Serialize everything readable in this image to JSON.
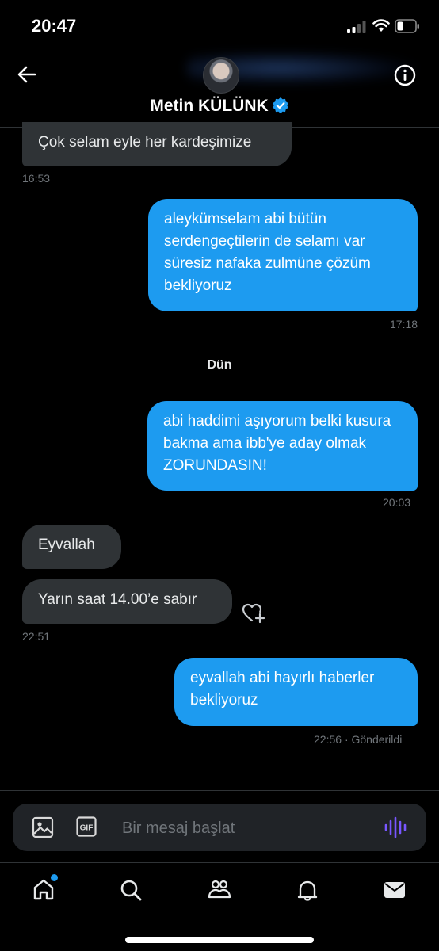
{
  "status_bar": {
    "time": "20:47",
    "icons": [
      "cellular-signal-icon",
      "wifi-icon",
      "battery-icon"
    ]
  },
  "header": {
    "contact_name": "Metin KÜLÜNK",
    "verified": true,
    "back_icon": "back-arrow-icon",
    "info_icon": "info-icon"
  },
  "messages": [
    {
      "direction": "incoming",
      "text": "Çok selam eyle her kardeşimize",
      "time": "16:53"
    },
    {
      "direction": "outgoing",
      "text": "aleykümselam abi bütün serdengeçtilerin de selamı var süresiz nafaka zulmüne çözüm bekliyoruz",
      "time": "17:18"
    },
    {
      "direction": "outgoing",
      "text": "abi haddimi aşıyorum belki kusura bakma ama ibb'ye aday olmak ZORUNDASIN!",
      "time": "20:03"
    },
    {
      "direction": "incoming",
      "text": "Eyvallah"
    },
    {
      "direction": "incoming",
      "text": "Yarın saat 14.00’e sabır",
      "time": "22:51"
    },
    {
      "direction": "outgoing",
      "text": "eyvallah abi hayırlı haberler bekliyoruz",
      "time": "22:56",
      "status": "· Gönderildi"
    }
  ],
  "day_separator": "Dün",
  "composer": {
    "placeholder": "Bir mesaj başlat",
    "value": "",
    "image_icon": "image-icon",
    "gif_icon": "gif-icon",
    "voice_icon": "voice-message-icon"
  },
  "tabs": [
    {
      "name": "home",
      "icon": "home-icon",
      "has_notification_dot": true
    },
    {
      "name": "search",
      "icon": "search-icon"
    },
    {
      "name": "communities",
      "icon": "communities-icon"
    },
    {
      "name": "notifications",
      "icon": "bell-icon"
    },
    {
      "name": "messages",
      "icon": "mail-icon",
      "active": true
    }
  ],
  "colors": {
    "background": "#000000",
    "incoming_bubble": "#2f3336",
    "outgoing_bubble": "#1d9bf0",
    "timestamp": "#71767b",
    "accent": "#1d9bf0",
    "voice_icon": "#7856ff"
  }
}
